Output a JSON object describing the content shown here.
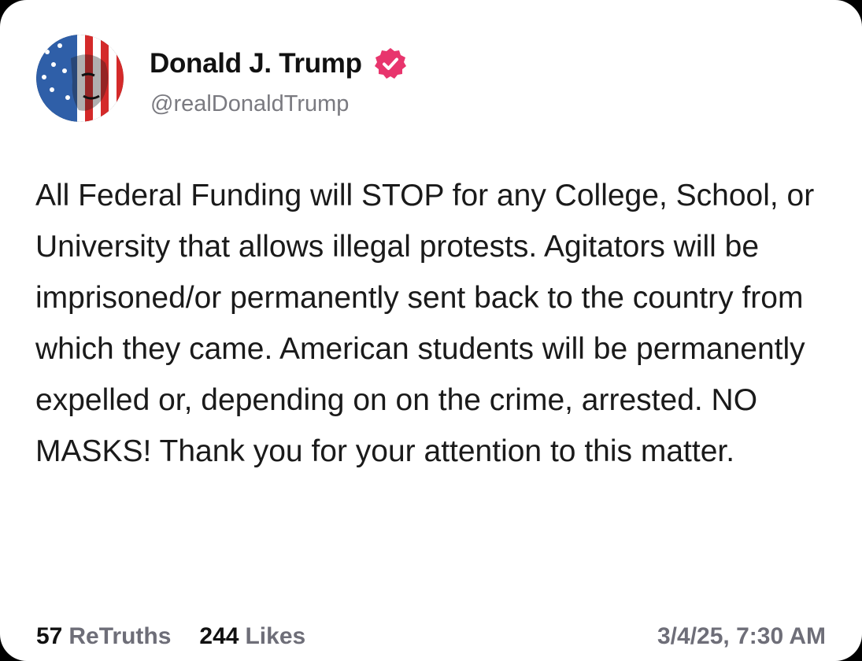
{
  "post": {
    "author": {
      "display_name": "Donald J. Trump",
      "handle": "@realDonaldTrump",
      "verified": true,
      "verified_color": "#e8356d"
    },
    "body": "All Federal Funding will STOP for any College, School, or University that allows illegal protests. Agitators will be imprisoned/or permanently sent back to the country from which they came. American students will be permanently expelled or, depending on on the crime, arrested. NO MASKS! Thank you for your attention to this matter.",
    "stats": {
      "retruths_count": "57",
      "retruths_label": "ReTruths",
      "likes_count": "244",
      "likes_label": "Likes"
    },
    "timestamp": "3/4/25, 7:30 AM"
  },
  "icons": {
    "avatar": "avatar-image",
    "verified": "verified-badge-icon"
  }
}
